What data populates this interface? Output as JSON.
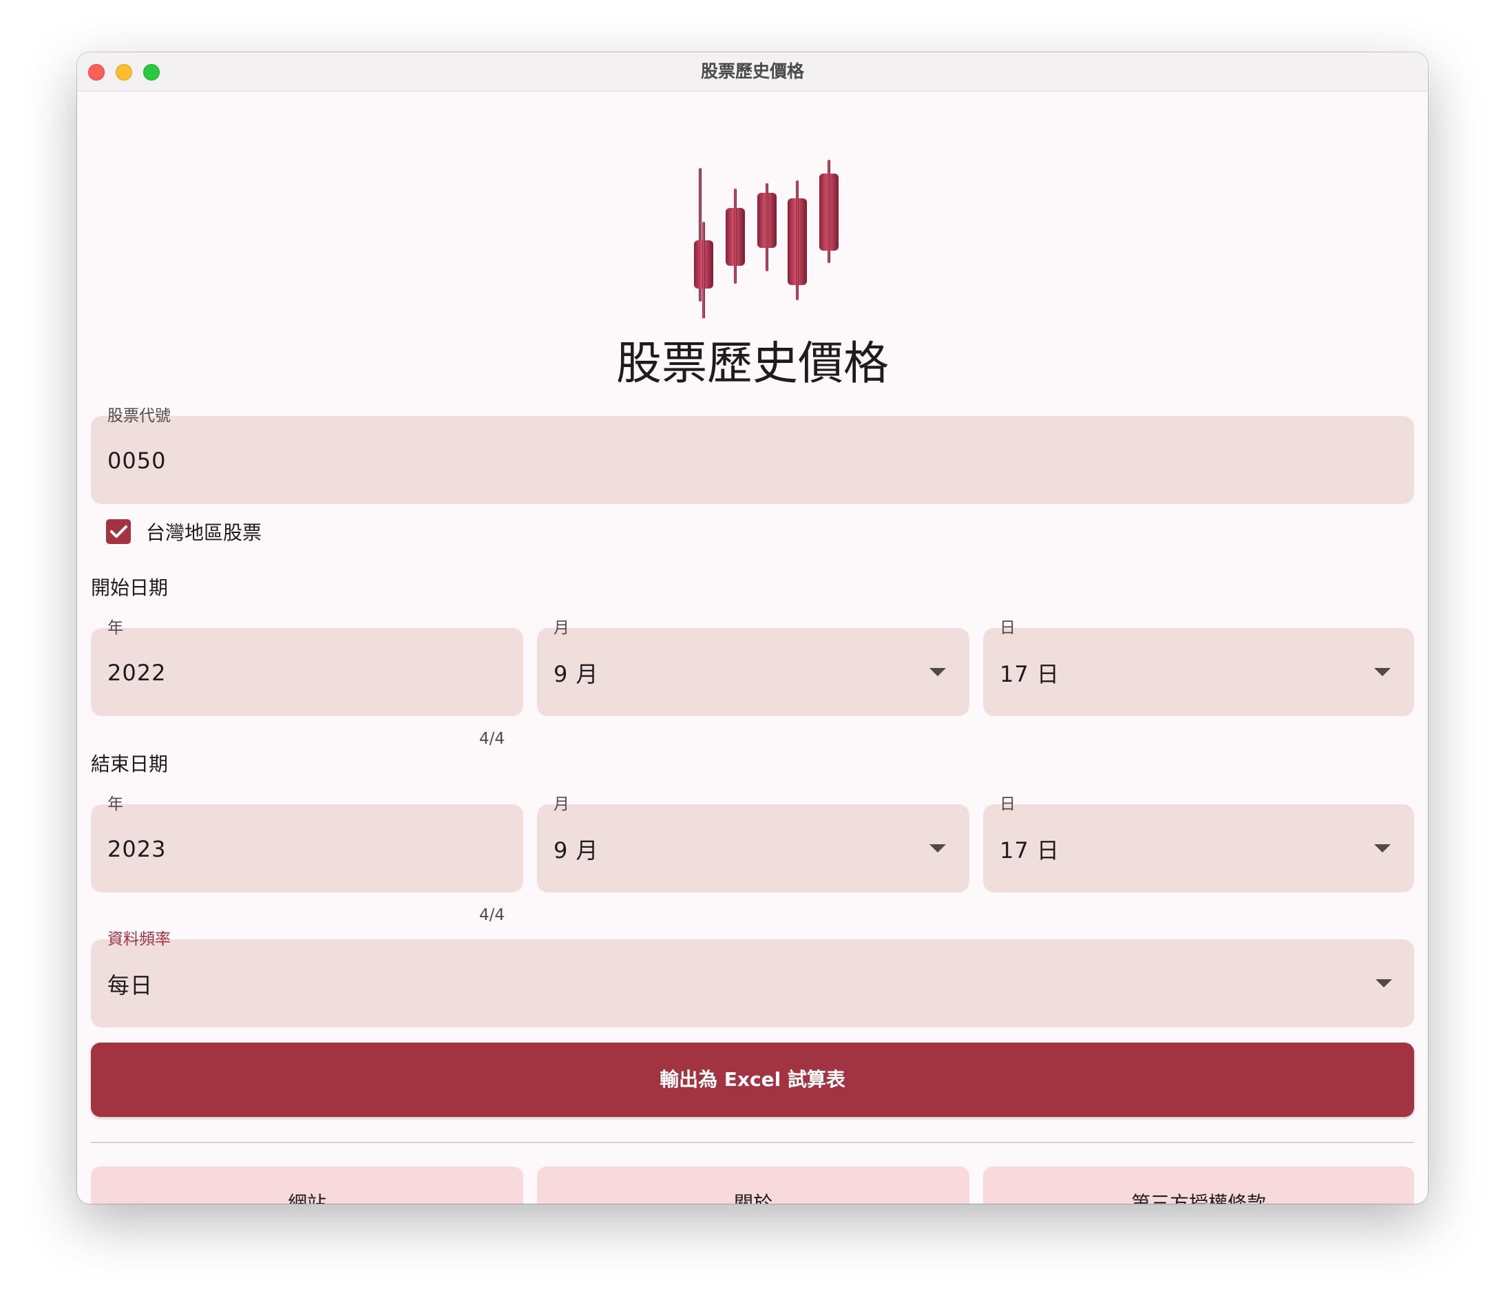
{
  "window": {
    "title": "股票歷史價格"
  },
  "header": {
    "logo_icon": "candlestick-chart-icon",
    "app_title": "股票歷史價格"
  },
  "stock_code": {
    "label": "股票代號",
    "value": "0050"
  },
  "taiwan_checkbox": {
    "label": "台灣地區股票",
    "checked": true
  },
  "start_date": {
    "section_label": "開始日期",
    "year_label": "年",
    "year_value": "2022",
    "year_counter": "4/4",
    "month_label": "月",
    "month_value": "9 月",
    "day_label": "日",
    "day_value": "17 日"
  },
  "end_date": {
    "section_label": "結束日期",
    "year_label": "年",
    "year_value": "2023",
    "year_counter": "4/4",
    "month_label": "月",
    "month_value": "9 月",
    "day_label": "日",
    "day_value": "17 日"
  },
  "frequency": {
    "label": "資料頻率",
    "value": "每日"
  },
  "export_button": {
    "label": "輸出為 Excel 試算表"
  },
  "footer_buttons": {
    "website": "網站",
    "about": "關於",
    "licenses": "第三方授權條款"
  },
  "colors": {
    "primary": "#a23442",
    "field_background": "#f0dedd",
    "tonal_button": "#f8dadd",
    "window_background": "#fdf8fa"
  }
}
